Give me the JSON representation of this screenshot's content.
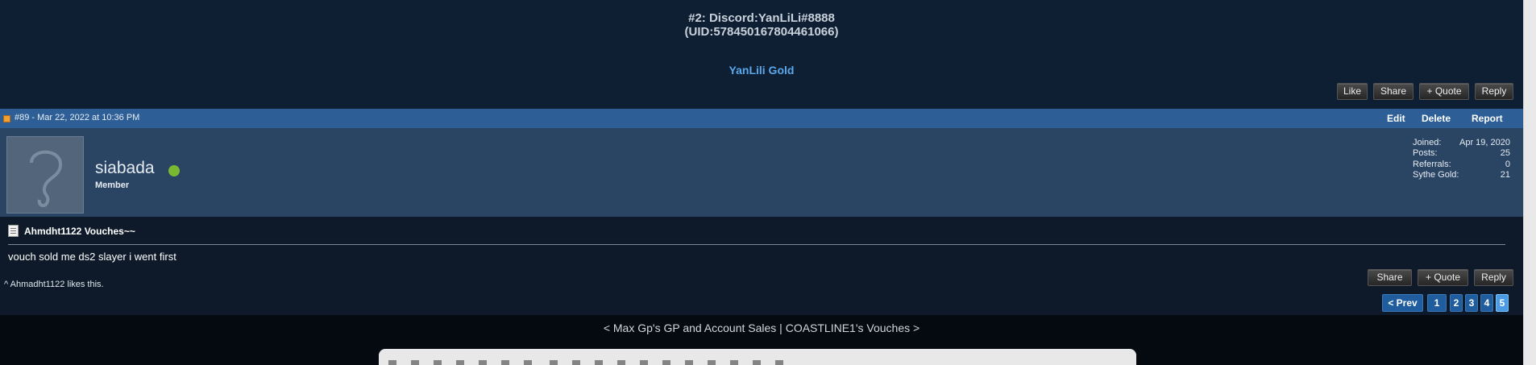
{
  "previous_post": {
    "signature_line1": "#2: Discord:YanLiLi#8888",
    "signature_line2": "(UID:578450167804461066)",
    "gold_link": "YanLili Gold",
    "buttons": {
      "like": "Like",
      "share": "Share",
      "quote": "+ Quote",
      "reply": "Reply"
    }
  },
  "post": {
    "id_date": "#89 - Mar 22, 2022 at 10:36 PM",
    "actions": {
      "edit": "Edit",
      "delete": "Delete",
      "report": "Report"
    },
    "user": {
      "name": "siabada",
      "title": "Member",
      "stats": {
        "joined_label": "Joined:",
        "joined_value": "Apr 19, 2020",
        "posts_label": "Posts:",
        "posts_value": "25",
        "referrals_label": "Referrals:",
        "referrals_value": "0",
        "gold_label": "Sythe Gold:",
        "gold_value": "21"
      },
      "online_color": "#78b832"
    },
    "thread_title": "Ahmdht1122 Vouches~~",
    "message": "vouch sold me ds2 slayer i went first",
    "likes": {
      "caret": "^",
      "user": "Ahmadht1122",
      "suffix": "likes this."
    },
    "buttons": {
      "share": "Share",
      "quote": "+ Quote",
      "reply": "Reply"
    }
  },
  "pagination": {
    "prev": "< Prev",
    "pages": [
      "1",
      "2",
      "3",
      "4",
      "5"
    ],
    "current": "5"
  },
  "thread_nav": "< Max Gp's GP and Account Sales | COASTLINE1's Vouches >",
  "colors": {
    "header_bar": "#2d5f96",
    "user_bar": "#2a4463",
    "link": "#5aa7ea",
    "page_bg": "#0e1a2a"
  }
}
